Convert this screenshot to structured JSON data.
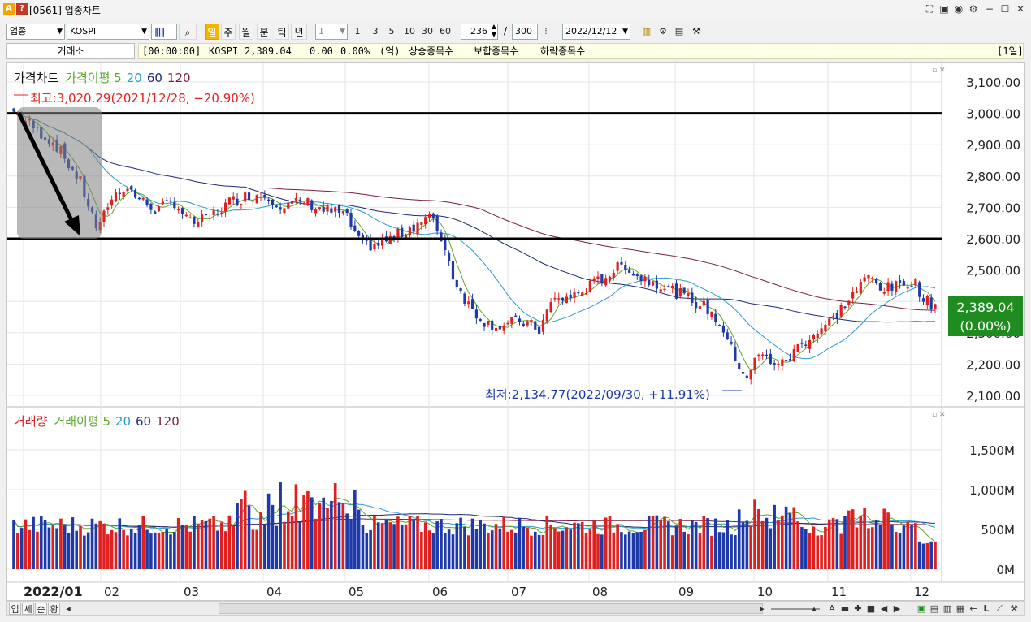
{
  "window": {
    "title": "[0561] 업종차트",
    "badge_a": "A",
    "badge_q": "?",
    "controls": [
      "☐",
      "−",
      "☐",
      "✕"
    ]
  },
  "toolbar": {
    "category": "업종",
    "index_name": "KOSPI",
    "periods": [
      "일",
      "주",
      "월",
      "분",
      "틱",
      "년"
    ],
    "active_period": "일",
    "unit_value": "1",
    "intervals": [
      "1",
      "3",
      "5",
      "10",
      "30",
      "60"
    ],
    "count_value": "236",
    "count_sep": "/",
    "count_total": "300",
    "date_value": "2022/12/12"
  },
  "infobar": {
    "exchange": "거래소",
    "time": "[00:00:00]",
    "index": "KOSPI",
    "price": "2,389.04",
    "change": "0.00",
    "change_pct": "0.00%",
    "unit": "(억)",
    "rising": "상승종목수",
    "flat": "보합종목수",
    "falling": "하락종목수",
    "period_tag": "[1일]"
  },
  "colors": {
    "up": "#e0201f",
    "down": "#1e3aa8",
    "ma5": "#5aa82a",
    "ma20": "#2a9bd0",
    "ma60": "#1e2a7a",
    "ma120": "#7a1f45",
    "price_badge": "#1e8c1e"
  },
  "price_panel": {
    "legend": [
      "가격차트",
      "가격이평 5",
      "20",
      "60",
      "120"
    ],
    "max_label": "최고:3,020.29(2021/12/28, −20.90%)",
    "min_label": "최저:2,134.77(2022/09/30, +11.91%)",
    "current_price": "2,389.04",
    "current_pct": "(0.00%)",
    "axis_labels": [
      "3,100.00",
      "3,000.00",
      "2,900.00",
      "2,800.00",
      "2,700.00",
      "2,600.00",
      "2,500.00",
      "2,300.00",
      "2,200.00",
      "2,100.00"
    ],
    "hline_levels": [
      3000,
      2600
    ]
  },
  "volume_panel": {
    "legend": [
      "거래량",
      "거래이평 5",
      "20",
      "60",
      "120"
    ],
    "axis_labels": [
      "1,500M",
      "1,000M",
      "500M",
      "0M"
    ]
  },
  "x_axis": {
    "labels": [
      "2022/01",
      "02",
      "03",
      "04",
      "05",
      "06",
      "07",
      "08",
      "09",
      "10",
      "11",
      "12"
    ]
  },
  "statusbar": {
    "buttons": [
      "업",
      "세",
      "순",
      "황"
    ],
    "right_letters": [
      "A",
      "L"
    ]
  }
}
